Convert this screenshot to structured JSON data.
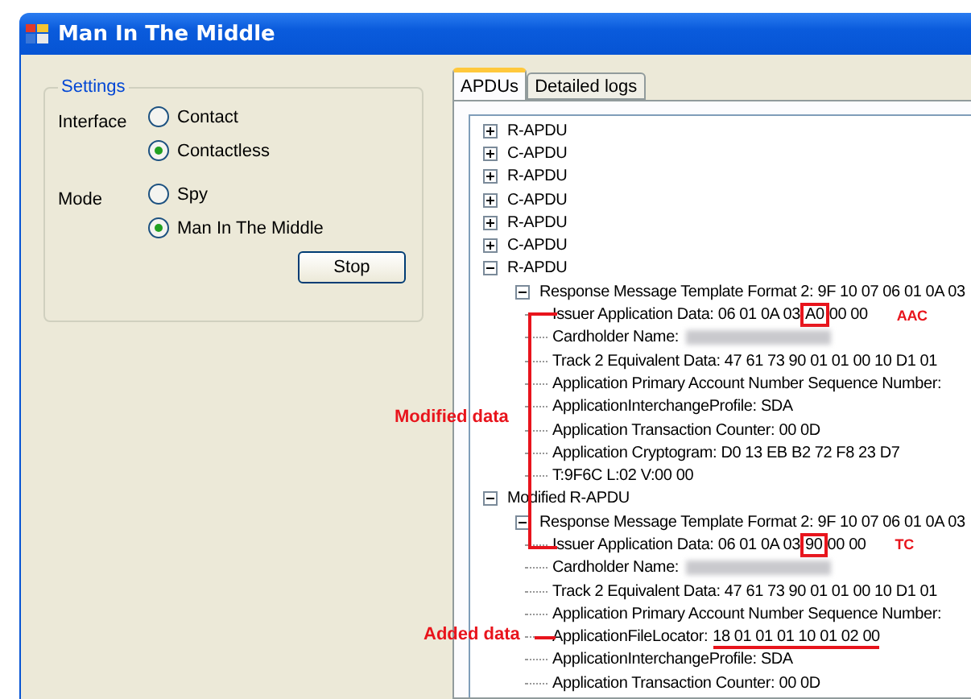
{
  "window": {
    "title": "Man In The Middle"
  },
  "settings": {
    "title": "Settings",
    "groups": [
      {
        "label": "Interface",
        "options": [
          {
            "label": "Contact",
            "selected": false
          },
          {
            "label": "Contactless",
            "selected": true
          }
        ]
      },
      {
        "label": "Mode",
        "options": [
          {
            "label": "Spy",
            "selected": false
          },
          {
            "label": "Man In The Middle",
            "selected": true
          }
        ]
      }
    ],
    "button": "Stop"
  },
  "tabs": [
    {
      "label": "APDUs",
      "selected": true
    },
    {
      "label": "Detailed logs",
      "selected": false
    }
  ],
  "tree": [
    {
      "text": "R-APDU",
      "expanded": false
    },
    {
      "text": "C-APDU",
      "expanded": false
    },
    {
      "text": "R-APDU",
      "expanded": false
    },
    {
      "text": "C-APDU",
      "expanded": false
    },
    {
      "text": "R-APDU",
      "expanded": false
    },
    {
      "text": "C-APDU",
      "expanded": false
    },
    {
      "text": "R-APDU",
      "expanded": true,
      "children": [
        {
          "text": "Response Message Template Format 2: 9F 10 07 06 01 0A 03",
          "expanded": true,
          "children": [
            {
              "parts": [
                {
                  "text": "Issuer Application Data: 06 01 0A 03",
                  "kind": "plain"
                },
                {
                  "text": "A0",
                  "kind": "boxed"
                },
                {
                  "text": "00 00",
                  "kind": "plain"
                }
              ],
              "note": "AAC"
            },
            {
              "text": "Cardholder Name:",
              "blurred": true
            },
            {
              "text": "Track 2 Equivalent Data: 47 61 73 90 01 01 00 10 D1 01"
            },
            {
              "text": "Application Primary Account Number Sequence Number:"
            },
            {
              "text": "ApplicationInterchangeProfile: SDA"
            },
            {
              "text": "Application Transaction Counter: 00 0D"
            },
            {
              "text": "Application Cryptogram: D0 13 EB B2 72 F8 23 D7"
            },
            {
              "text": "T:9F6C L:02 V:00 00"
            }
          ]
        }
      ]
    },
    {
      "text": "Modified R-APDU",
      "expanded": true,
      "children": [
        {
          "text": "Response Message Template Format 2: 9F 10 07 06 01 0A 03",
          "expanded": true,
          "children": [
            {
              "parts": [
                {
                  "text": "Issuer Application Data: 06 01 0A 03",
                  "kind": "plain"
                },
                {
                  "text": "90",
                  "kind": "boxed"
                },
                {
                  "text": "00 00",
                  "kind": "plain"
                }
              ],
              "note": "TC"
            },
            {
              "text": "Cardholder Name:",
              "blurred": true
            },
            {
              "text": "Track 2 Equivalent Data: 47 61 73 90 01 01 00 10 D1 01"
            },
            {
              "text": "Application Primary Account Number Sequence Number:"
            },
            {
              "parts": [
                {
                  "text": "ApplicationFileLocator:",
                  "kind": "plain"
                },
                {
                  "text": "18 01 01 01 10 01 02 00",
                  "kind": "underlined"
                }
              ]
            },
            {
              "text": "ApplicationInterchangeProfile: SDA"
            },
            {
              "text": "Application Transaction Counter: 00 0D"
            }
          ]
        }
      ]
    }
  ],
  "annotations": [
    {
      "kind": "bracket",
      "text": "Modified data"
    },
    {
      "kind": "pointer",
      "text": "Added data"
    }
  ]
}
